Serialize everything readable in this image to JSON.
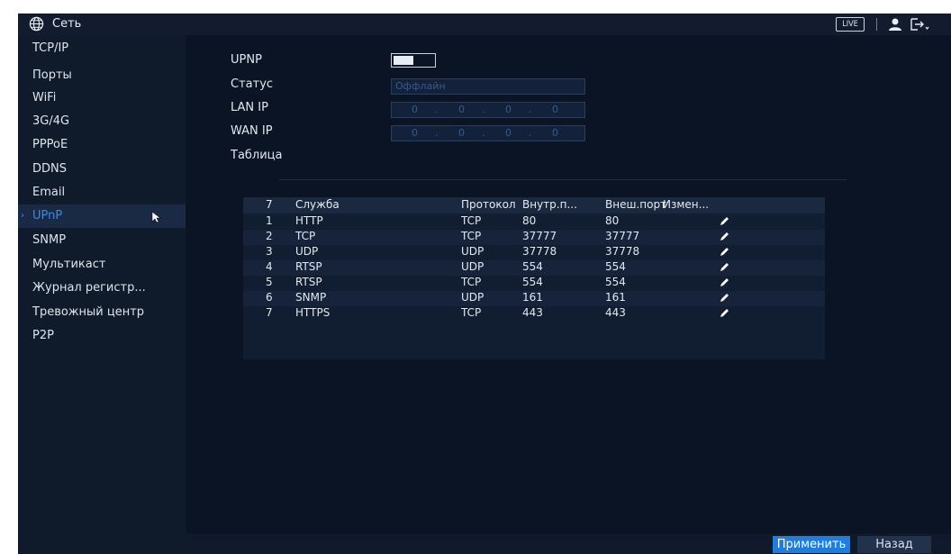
{
  "topbar": {
    "title": "Сеть",
    "live_label": "LIVE"
  },
  "sidebar": {
    "items": [
      {
        "label": "TCP/IP"
      },
      {
        "label": "Порты"
      },
      {
        "label": "WiFi"
      },
      {
        "label": "3G/4G"
      },
      {
        "label": "PPPoE"
      },
      {
        "label": "DDNS"
      },
      {
        "label": "Email"
      },
      {
        "label": "UPnP",
        "active": true
      },
      {
        "label": "SNMP"
      },
      {
        "label": "Мультикаст"
      },
      {
        "label": "Журнал регистр..."
      },
      {
        "label": "Тревожный центр"
      },
      {
        "label": "P2P"
      }
    ]
  },
  "form": {
    "upnp_label": "UPNP",
    "upnp_enabled": false,
    "status_label": "Статус",
    "status_value": "Оффлайн",
    "lan_ip_label": "LAN IP",
    "lan_ip": [
      "0",
      "0",
      "0",
      "0"
    ],
    "wan_ip_label": "WAN IP",
    "wan_ip": [
      "0",
      "0",
      "0",
      "0"
    ],
    "table_label": "Таблица"
  },
  "table": {
    "headers": [
      "7",
      "Служба",
      "Протокол",
      "Внутр.п...",
      "Внеш.порт",
      "Измен..."
    ],
    "rows": [
      [
        "1",
        "HTTP",
        "TCP",
        "80",
        "80"
      ],
      [
        "2",
        "TCP",
        "TCP",
        "37777",
        "37777"
      ],
      [
        "3",
        "UDP",
        "UDP",
        "37778",
        "37778"
      ],
      [
        "4",
        "RTSP",
        "UDP",
        "554",
        "554"
      ],
      [
        "5",
        "RTSP",
        "TCP",
        "554",
        "554"
      ],
      [
        "6",
        "SNMP",
        "UDP",
        "161",
        "161"
      ],
      [
        "7",
        "HTTPS",
        "TCP",
        "443",
        "443"
      ]
    ]
  },
  "buttons": {
    "apply": "Применить",
    "back": "Назад"
  },
  "colors": {
    "accent": "#1d7ee0",
    "active_text": "#2f8df0",
    "background": "#0b1424"
  }
}
